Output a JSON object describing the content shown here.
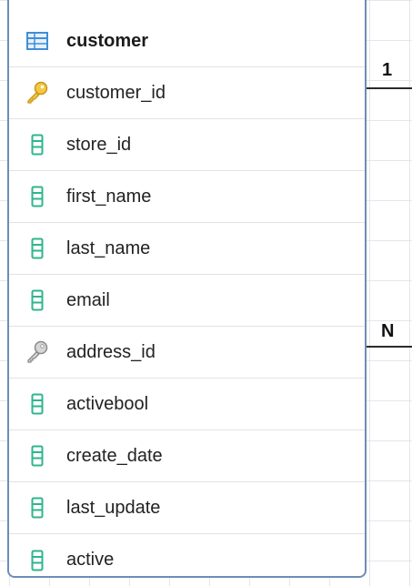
{
  "table": {
    "name": "customer",
    "columns": [
      {
        "name": "customer_id",
        "icon": "primary-key-icon"
      },
      {
        "name": "store_id",
        "icon": "column-icon"
      },
      {
        "name": "first_name",
        "icon": "column-icon"
      },
      {
        "name": "last_name",
        "icon": "column-icon"
      },
      {
        "name": "email",
        "icon": "column-icon"
      },
      {
        "name": "address_id",
        "icon": "foreign-key-icon"
      },
      {
        "name": "activebool",
        "icon": "column-icon"
      },
      {
        "name": "create_date",
        "icon": "column-icon"
      },
      {
        "name": "last_update",
        "icon": "column-icon"
      },
      {
        "name": "active",
        "icon": "column-icon"
      }
    ]
  },
  "relationships": [
    {
      "cardinality": "1"
    },
    {
      "cardinality": "N"
    }
  ],
  "colors": {
    "card_border": "#6c8db8",
    "grid": "#e3e6ea",
    "primary_key": "#e8b923",
    "foreign_key": "#9a9a9a",
    "column": "#2fb58e",
    "table_icon": "#3f8fd6"
  }
}
